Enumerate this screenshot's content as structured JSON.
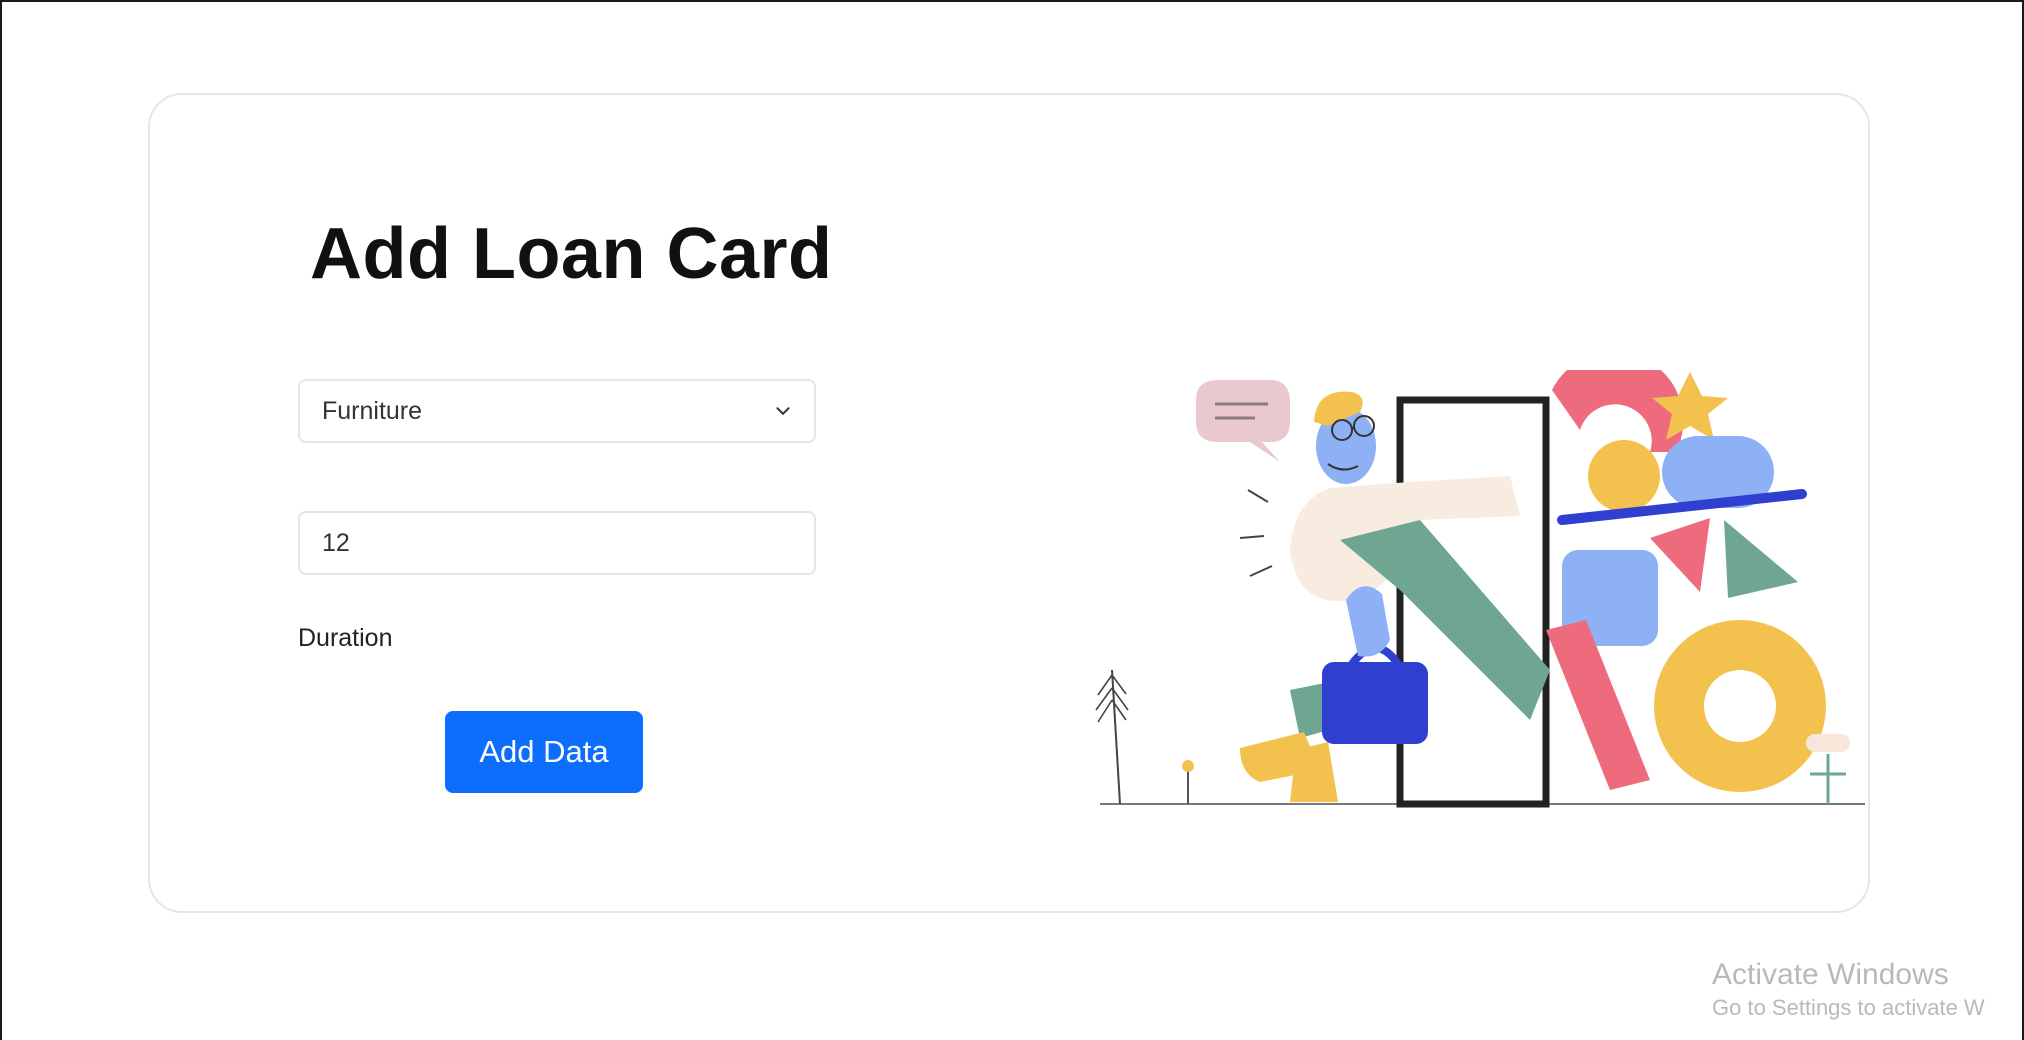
{
  "form": {
    "title": "Add Loan Card",
    "category_select": {
      "selected": "Furniture"
    },
    "duration_input": {
      "value": "12"
    },
    "duration_label": "Duration",
    "submit_label": "Add Data"
  },
  "illustration": {
    "icon": "person-with-shapes-illustration"
  },
  "watermark": {
    "title": "Activate Windows",
    "subtitle": "Go to Settings to activate W"
  },
  "colors": {
    "primary": "#0d6efd",
    "card_border": "#e4e6e9",
    "watermark": "#b9b9b9"
  }
}
